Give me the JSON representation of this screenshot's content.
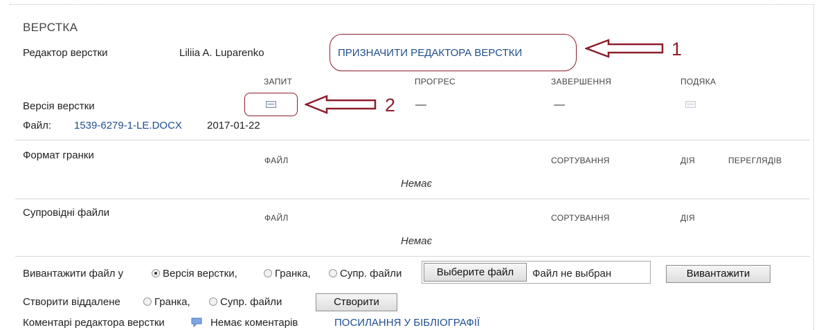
{
  "section_title": "ВЕРСТКА",
  "editor_row": {
    "label": "Редактор верстки",
    "name": "Liliia A. Luparenko",
    "assign_link": "ПРИЗНАЧИТИ РЕДАКТОРА ВЕРСТКИ"
  },
  "workflow_headers": {
    "request": "ЗАПИТ",
    "progress": "ПРОГРЕС",
    "completion": "ЗАВЕРШЕННЯ",
    "thanks": "ПОДЯКА"
  },
  "layout_version": {
    "label": "Версія верстки",
    "progress_value": "—",
    "completion_value": "—",
    "file_label": "Файл:",
    "file_link": "1539-6279-1-LE.DOCX",
    "file_date": "2017-01-22"
  },
  "galley_format": {
    "label": "Формат гранки",
    "col_file": "ФАЙЛ",
    "col_sort": "СОРТУВАННЯ",
    "col_action": "ДІЯ",
    "col_views": "ПЕРЕГЛЯДІВ",
    "empty": "Немає"
  },
  "supp_files": {
    "label": "Супровідні файли",
    "col_file": "ФАЙЛ",
    "col_sort": "СОРТУВАННЯ",
    "col_action": "ДІЯ",
    "empty": "Немає"
  },
  "upload": {
    "label": "Вивантажити файл у",
    "opt_layout": "Версія верстки,",
    "opt_galley": "Гранка,",
    "opt_supp": "Супр. файли",
    "choose_button": "Выберите файл",
    "no_file": "Файл не выбран",
    "upload_button": "Вивантажити"
  },
  "create_remote": {
    "label": "Створити віддалене",
    "opt_galley": "Гранка,",
    "opt_supp": "Супр. файли",
    "create_button": "Створити"
  },
  "comments": {
    "label": "Коментарі редактора верстки",
    "no_comments": "Немає коментарів",
    "citations_link": "ПОСИЛАННЯ У БІБЛІОГРАФІЇ"
  },
  "annotations": {
    "num1": "1",
    "num2": "2",
    "color": "#8b1e2a"
  }
}
